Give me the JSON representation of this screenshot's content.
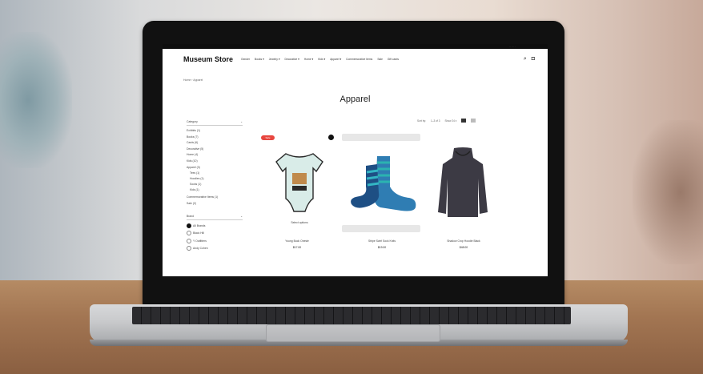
{
  "store": {
    "logo": "Museum Store",
    "topbar_text": "·· ··· ·",
    "menu": [
      "Gender",
      "Books ▾",
      "Jewelry ▾",
      "Decorative ▾",
      "Home ▾",
      "Kids ▾",
      "Apparel ▾",
      "Commemorative Items",
      "Sale",
      "Gift cards"
    ],
    "icons": [
      "search-icon",
      "bag-icon"
    ],
    "breadcrumb": "Home › Apparel",
    "page_title": "Apparel",
    "sort": {
      "label": "Sort by:",
      "pager": "1–3 of 3",
      "per_page": "Show 24 ▾",
      "views": [
        "grid-view-icon",
        "list-view-icon"
      ]
    },
    "filters": {
      "category_label": "Category",
      "categories": [
        "Exhibits (1)",
        "Books (7)",
        "Cards (6)",
        "Decorative (5)",
        "Home (4)",
        "Kids (10)",
        "Apparel (3)"
      ],
      "subcategories": [
        "Tees (1)",
        "Hoodies (1)",
        "Socks (1)",
        "Kids (1)"
      ],
      "extra": [
        "Commemorative Items (1)",
        "Sale (2)"
      ],
      "brand_label": "Brand",
      "brands": [
        {
          "label": "All Brands",
          "selected": true
        },
        {
          "label": "Black Hill",
          "selected": false
        },
        {
          "label": "Y Outfitters",
          "selected": false
        },
        {
          "label": "Andy Cohen",
          "selected": false
        }
      ]
    },
    "badge": "Sale",
    "products": [
      {
        "name": "Young Buck Onesie",
        "price": "$17.00",
        "sub_label": "Select options"
      },
      {
        "name": "Stripe Swirl Sock Knits",
        "price": "$19.00"
      },
      {
        "name": "Shadow Crop Hoodie Black",
        "price": "$48.00"
      }
    ],
    "colors": {
      "badge": "#e8463f",
      "text": "#333333",
      "logo": "#111111"
    }
  }
}
